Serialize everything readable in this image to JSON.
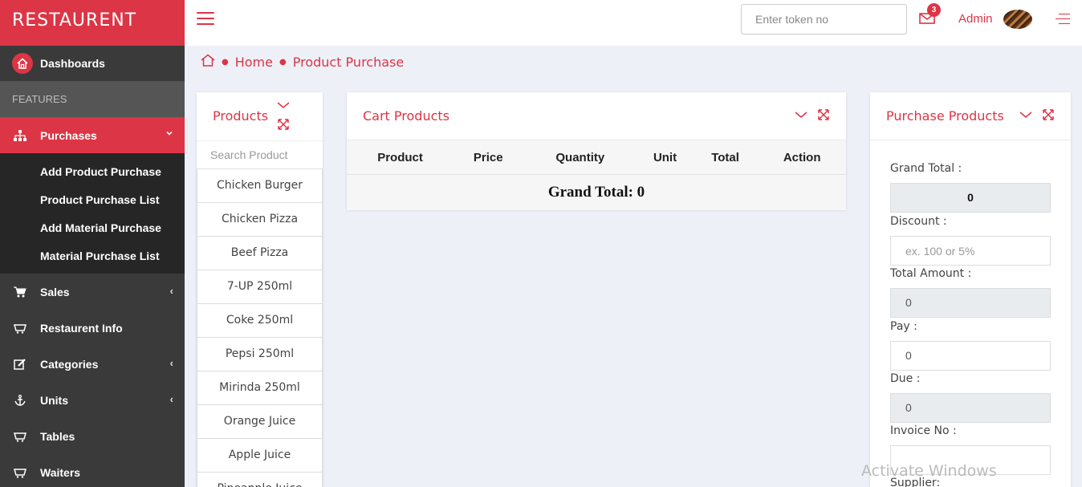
{
  "brand": "RESTAURENT",
  "sidebar": {
    "dashboard": "Dashboards",
    "section": "FEATURES",
    "purchases": "Purchases",
    "submenu": [
      "Add Product Purchase",
      "Product Purchase List",
      "Add Material Purchase",
      "Material Purchase List"
    ],
    "items": [
      {
        "label": "Sales",
        "chevron": "‹",
        "icon": "cart-icon"
      },
      {
        "label": "Restaurent Info",
        "chevron": "",
        "icon": "basket-icon"
      },
      {
        "label": "Categories",
        "chevron": "‹",
        "icon": "edit-icon"
      },
      {
        "label": "Units",
        "chevron": "‹",
        "icon": "anchor-icon"
      },
      {
        "label": "Tables",
        "chevron": "",
        "icon": "basket-icon"
      },
      {
        "label": "Waiters",
        "chevron": "",
        "icon": "basket-icon"
      }
    ]
  },
  "topbar": {
    "token_placeholder": "Enter token no",
    "mail_count": "3",
    "user": "Admin"
  },
  "breadcrumb": {
    "home": "Home",
    "current": "Product Purchase"
  },
  "products": {
    "title": "Products",
    "search_placeholder": "Search Product",
    "items": [
      "Chicken Burger",
      "Chicken Pizza",
      "Beef Pizza",
      "7-UP 250ml",
      "Coke 250ml",
      "Pepsi 250ml",
      "Mirinda 250ml",
      "Orange Juice",
      "Apple Juice",
      "Pineapple Juice"
    ]
  },
  "cart": {
    "title": "Cart Products",
    "columns": [
      "Product",
      "Price",
      "Quantity",
      "Unit",
      "Total",
      "Action"
    ],
    "grand_total": "Grand Total: 0"
  },
  "purchase": {
    "title": "Purchase Products",
    "grand_total_label": "Grand Total :",
    "grand_total_value": "0",
    "discount_label": "Discount :",
    "discount_placeholder": "ex. 100 or 5%",
    "total_amount_label": "Total Amount :",
    "total_amount_value": "0",
    "pay_label": "Pay :",
    "pay_value": "0",
    "due_label": "Due :",
    "due_value": "0",
    "invoice_label": "Invoice No :",
    "invoice_value": "",
    "supplier_label": "Supplier:"
  },
  "watermark": "Activate Windows",
  "colors": {
    "accent": "#dc3545",
    "sidebar": "#3a3a3a",
    "submenu": "#262626"
  }
}
